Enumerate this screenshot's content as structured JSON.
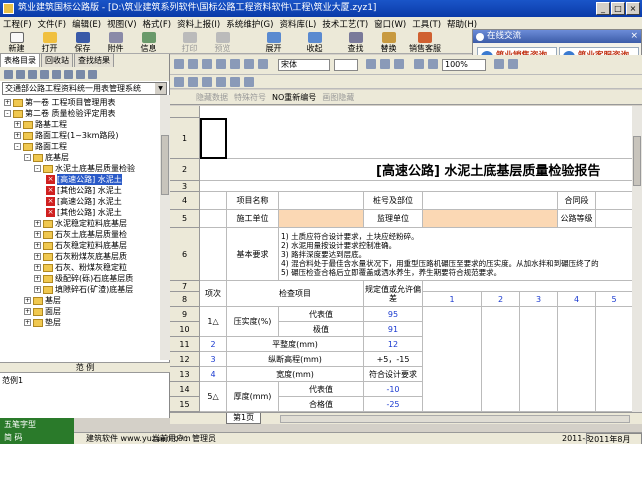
{
  "window": {
    "title": "筑业建筑国标公路版 - [D:\\筑业建筑系列软件\\国标公路工程资料软件\\工程\\筑业大厦.zyz1]",
    "btn_min": "_",
    "btn_max": "□",
    "btn_close": "×"
  },
  "menu": [
    "工程(F)",
    "文件(F)",
    "编辑(E)",
    "视图(V)",
    "格式(F)",
    "资料上报(I)",
    "系统维护(G)",
    "资料库(L)",
    "技术工艺(T)",
    "窗口(W)",
    "工具(T)",
    "帮助(H)"
  ],
  "toolbar": {
    "buttons": [
      "新建",
      "打开",
      "保存",
      "附件",
      "信息",
      "打印",
      "预览",
      "展开",
      "收起",
      "查找",
      "替换",
      "销售客服"
    ]
  },
  "chat": {
    "title": "在线交流",
    "close": "×",
    "sales": "筑业销售咨询",
    "service": "筑业客服咨询"
  },
  "left": {
    "tabs": [
      "表格目录",
      "回收站",
      "查找结果"
    ],
    "combo": "交通部公路工程资料统一用表管理系统",
    "combo_arrow": "▼",
    "expand_glyph": "-",
    "collapse_glyph": "+",
    "x_glyph": "×",
    "tree": [
      {
        "label": "第一卷 工程项目管理用表"
      },
      {
        "label": "第二卷 质量检验评定用表"
      },
      {
        "label": "路基工程"
      },
      {
        "label": "路面工程(1~3km路段)"
      },
      {
        "label": "路面工程"
      },
      {
        "label": "底基层"
      },
      {
        "label": "水泥土底基层质量检验"
      },
      {
        "label": "[高速公路] 水泥土"
      },
      {
        "label": "[其他公路] 水泥土"
      },
      {
        "label": "[高速公路] 水泥土"
      },
      {
        "label": "[其他公路] 水泥土"
      },
      {
        "label": "水泥稳定粒料底基层"
      },
      {
        "label": "石灰土底基层质量检"
      },
      {
        "label": "石灰稳定粒料底基层"
      },
      {
        "label": "石灰粉煤灰底基层质"
      },
      {
        "label": "石灰、粉煤灰稳定粒"
      },
      {
        "label": "级配碎(砾)石底基层质"
      },
      {
        "label": "填隙碎石(矿渣)底基层"
      },
      {
        "label": "基层"
      },
      {
        "label": "面层"
      },
      {
        "label": "垫层"
      }
    ],
    "example_header": "范      例",
    "example_item": "范例1"
  },
  "ime": {
    "line1": "五笔字型",
    "line2": "简 码"
  },
  "format": {
    "font": "宋体",
    "zoom": "100%",
    "row3": [
      "隐藏数据",
      "特殊符号",
      "NO重新编号",
      "画图隐藏"
    ]
  },
  "sheet": {
    "columns": [
      "A",
      "B",
      "C",
      "D",
      "E",
      "F",
      "G",
      "H",
      "I",
      "J",
      "K"
    ],
    "rows": [
      "1",
      "2",
      "3",
      "4",
      "5",
      "6",
      "7",
      "8",
      "9",
      "10",
      "11",
      "12",
      "13",
      "14",
      "15"
    ],
    "title": "[高速公路] 水泥土底基层质量检验报告",
    "project_name": "项目名称",
    "pile_location": "桩号及部位",
    "contract": "合同段",
    "construction_unit": "施工单位",
    "supervision_unit": "监理单位",
    "road_grade": "公路等级",
    "basic_req": "基本要求",
    "basic_lines": [
      "1) 土质应符合设计要求，土块应经粉碎。",
      "2) 水泥用量按设计要求控制准确。",
      "3) 路拌深度要达到层底。",
      "4) 混合料处于最佳含水量状况下，用重型压路机碾压至要求的压实度。从加水拌和到碾压终了的",
      "5) 碾压检查合格后立即覆盖或洒水养生，养生期要符合规范要求。"
    ],
    "item_no": "项次",
    "check_item": "检查项目",
    "spec_value": "规定值或允许偏差",
    "nums": [
      "1",
      "2",
      "3",
      "4",
      "5"
    ],
    "r9": [
      "1△",
      "压实度(%)",
      "代表值",
      "95"
    ],
    "r10": [
      "极值",
      "91"
    ],
    "r11": [
      "2",
      "平整度(mm)",
      "12"
    ],
    "r12": [
      "3",
      "纵断高程(mm)",
      "+5，-15"
    ],
    "r13": [
      "4",
      "宽度(mm)",
      "符合设计要求"
    ],
    "r14": [
      "5△",
      "厚度(mm)",
      "代表值",
      "-10"
    ],
    "r15": [
      "合格值",
      "-25"
    ],
    "sheet_tab": "第1页"
  },
  "status": {
    "company": "建筑软件 www.yuzuan.com",
    "user": "当前用户：管理员",
    "date1": "2011-8",
    "date2": "2011年8月10日"
  }
}
